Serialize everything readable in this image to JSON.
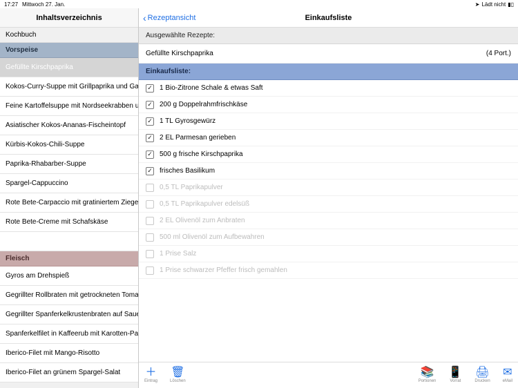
{
  "statusbar": {
    "time": "17:27",
    "date": "Mittwoch 27. Jan.",
    "loading": "Lädt nicht"
  },
  "sidebar": {
    "title": "Inhaltsverzeichnis",
    "subtitle": "Kochbuch",
    "categories": [
      {
        "name": "Vorspeise",
        "style": "vorspeise",
        "recipes": [
          {
            "label": "Gefüllte Kirschpaprika",
            "selected": true
          },
          {
            "label": "Kokos-Curry-Suppe mit Grillpaprika und Garn..."
          },
          {
            "label": "Feine Kartoffelsuppe mit Nordseekrabben un..."
          },
          {
            "label": "Asiatischer Kokos-Ananas-Fischeintopf"
          },
          {
            "label": "Kürbis-Kokos-Chili-Suppe"
          },
          {
            "label": "Paprika-Rhabarber-Suppe"
          },
          {
            "label": "Spargel-Cappuccino"
          },
          {
            "label": "Rote Bete-Carpaccio mit gratiniertem Ziegen..."
          },
          {
            "label": "Rote Bete-Creme mit Schafskäse"
          }
        ]
      },
      {
        "name": "Fleisch",
        "style": "fleisch",
        "recipes": [
          {
            "label": "Gyros am Drehspieß"
          },
          {
            "label": "Gegrillter Rollbraten mit getrockneten Tomaten"
          },
          {
            "label": "Gegrillter Spanferkelkrustenbraten auf Sauer..."
          },
          {
            "label": "Spanferkelfilet in Kaffeerub mit Karotten-Past..."
          },
          {
            "label": "Iberico-Filet mit Mango-Risotto"
          },
          {
            "label": "Iberico-Filet an grünem Spargel-Salat"
          }
        ]
      }
    ]
  },
  "main": {
    "back_label": "Rezeptansicht",
    "title": "Einkaufsliste",
    "section_selected_label": "Ausgewählte Rezepte:",
    "selected_recipe": {
      "name": "Gefüllte Kirschpaprika",
      "portions": "(4 Port.)"
    },
    "section_list_label": "Einkaufsliste:",
    "ingredients": [
      {
        "checked": true,
        "text": "1 Bio-Zitrone Schale & etwas Saft"
      },
      {
        "checked": true,
        "text": "200 g Doppelrahmfrischkäse"
      },
      {
        "checked": true,
        "text": "1 TL Gyrosgewürz"
      },
      {
        "checked": true,
        "text": "2 EL Parmesan gerieben"
      },
      {
        "checked": true,
        "text": "500 g frische Kirschpaprika"
      },
      {
        "checked": true,
        "text": "frisches Basilikum"
      },
      {
        "checked": false,
        "text": "0,5 TL Paprikapulver"
      },
      {
        "checked": false,
        "text": "0,5 TL Paprikapulver edelsüß"
      },
      {
        "checked": false,
        "text": "2 EL Olivenöl zum Anbraten"
      },
      {
        "checked": false,
        "text": "500 ml Olivenöl zum Aufbewahren"
      },
      {
        "checked": false,
        "text": "1 Prise Salz"
      },
      {
        "checked": false,
        "text": "1 Prise schwarzer Pfeffer frisch gemahlen"
      }
    ]
  },
  "toolbar": {
    "left": [
      {
        "icon": "plus",
        "name": "add-entry-button",
        "label": "Eintrag"
      },
      {
        "icon": "trash",
        "name": "delete-button",
        "label": "Löschen"
      }
    ],
    "right": [
      {
        "icon": "books",
        "name": "portions-button",
        "label": "Portionen"
      },
      {
        "icon": "phone",
        "name": "supply-button",
        "label": "Vorrat"
      },
      {
        "icon": "printer",
        "name": "print-button",
        "label": "Drucken"
      },
      {
        "icon": "mail",
        "name": "email-button",
        "label": "eMail"
      }
    ]
  },
  "icons": {
    "plus": "＋",
    "trash": "🗑",
    "books": "📚",
    "phone": "📱",
    "printer": "🖨",
    "mail": "✉",
    "location": "➤",
    "battery": "▮▯"
  }
}
